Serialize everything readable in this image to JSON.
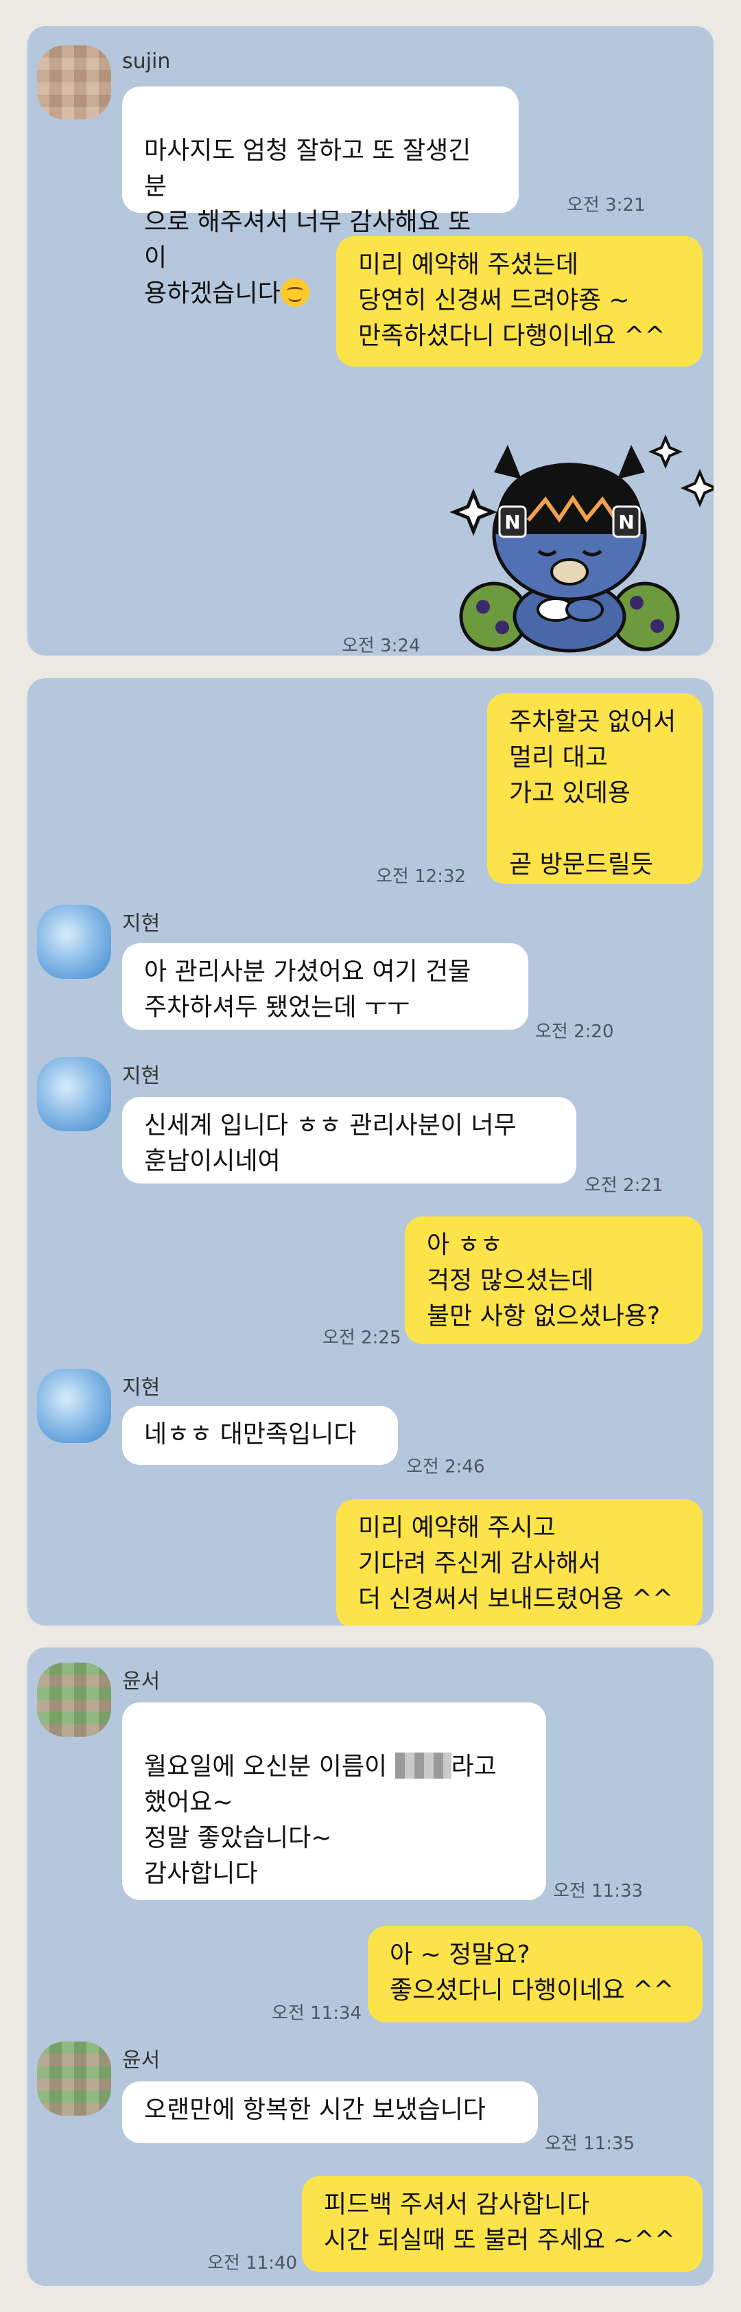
{
  "panel1": {
    "sender": "sujin",
    "msg1_pre": "마사지도 엄청 잘하고 또 잘생긴 분\n으로 해주셔서 너무 감사해요 또 이\n용하겠습니다",
    "msg1_time": "오전 3:21",
    "reply1": "미리 예약해 주셨는데\n당연히 신경써 드려야죵 ~\n만족하셨다니 다행이네요 ^^",
    "sticker_time": "오전 3:24"
  },
  "panel2": {
    "out1": "주차할곳 없어서\n멀리 대고\n가고 있데용\n\n곧 방문드릴듯",
    "out1_time": "오전 12:32",
    "sender": "지현",
    "in1": "아 관리사분 가셨어요 여기 건물\n주차하셔두 됐었는데 ㅜㅜ",
    "in1_time": "오전 2:20",
    "in2": "신세계 입니다 ㅎㅎ 관리사분이 너무\n훈남이시네여",
    "in2_time": "오전 2:21",
    "out2": "아 ㅎㅎ\n걱정 많으셨는데\n불만 사항 없으셨나용?",
    "out2_time": "오전 2:25",
    "in3": "네ㅎㅎ 대만족입니다",
    "in3_time": "오전 2:46",
    "out3": "미리 예약해 주시고\n기다려 주신게 감사해서\n더 신경써서 보내드렸어용 ^^"
  },
  "panel3": {
    "sender": "윤서",
    "in1_pre": "월요일에 오신분 이름이 ",
    "in1_post": "라고\n했어요~\n정말 좋았습니다~\n감사합니다",
    "in1_time": "오전 11:33",
    "out1": "아 ~ 정말요?\n좋으셨다니 다행이네요 ^^",
    "out1_time": "오전 11:34",
    "in2": "오랜만에 항복한 시간 보냈습니다",
    "in2_time": "오전 11:35",
    "out2": "피드백 주셔서 감사합니다\n시간 되실때 또 불러 주세요 ~^^",
    "out2_time": "오전 11:40"
  },
  "colors": {
    "chat_background": "#b5c7dc",
    "outgoing_bubble": "#fde34a",
    "incoming_bubble": "#ffffff"
  }
}
